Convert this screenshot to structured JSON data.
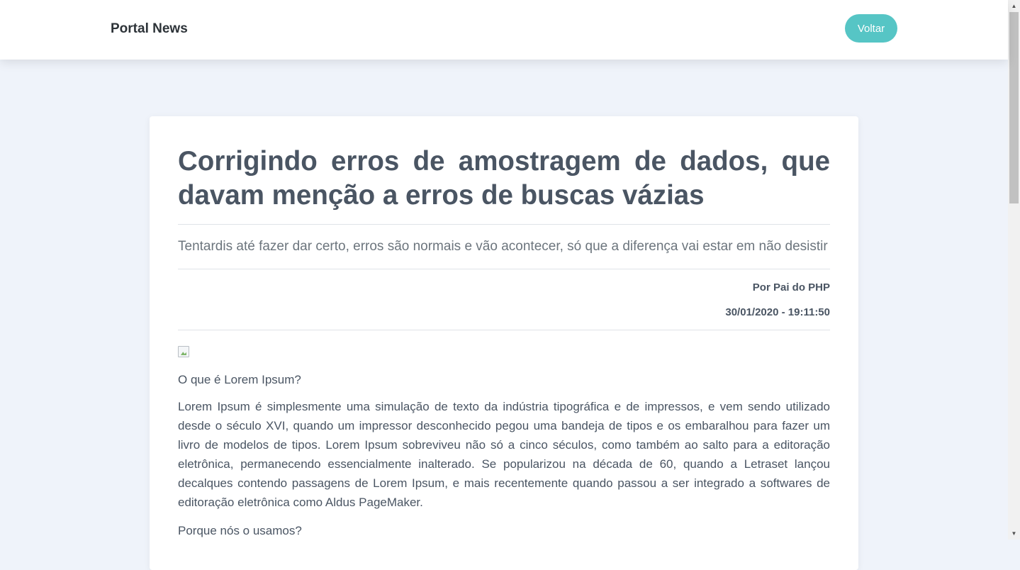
{
  "navbar": {
    "brand": "Portal News",
    "back_label": "Voltar"
  },
  "article": {
    "title": "Corrigindo erros de amostragem de dados, que davam menção a erros de buscas vázias",
    "subtitle": "Tentardis até fazer dar certo, erros são normais e vão acontecer, só que a diferença vai estar em não desistir",
    "author": "Por Pai do PHP",
    "datetime": "30/01/2020 - 19:11:50",
    "question1": "O que é Lorem Ipsum?",
    "paragraph1": "Lorem Ipsum é simplesmente uma simulação de texto da indústria tipográfica e de impressos, e vem sendo utilizado desde o século XVI, quando um impressor desconhecido pegou uma bandeja de tipos e os embaralhou para fazer um livro de modelos de tipos. Lorem Ipsum sobreviveu não só a cinco séculos, como também ao salto para a editoração eletrônica, permanecendo essencialmente inalterado. Se popularizou na década de 60, quando a Letraset lançou decalques contendo passagens de Lorem Ipsum, e mais recentemente quando passou a ser integrado a softwares de editoração eletrônica como Aldus PageMaker.",
    "question2": "Porque nós o usamos?"
  },
  "scrollbar": {
    "up_icon": "▲",
    "down_icon": "▼"
  },
  "colors": {
    "accent": "#56c5c5",
    "background": "#eff3fa",
    "text": "#4a5563"
  }
}
